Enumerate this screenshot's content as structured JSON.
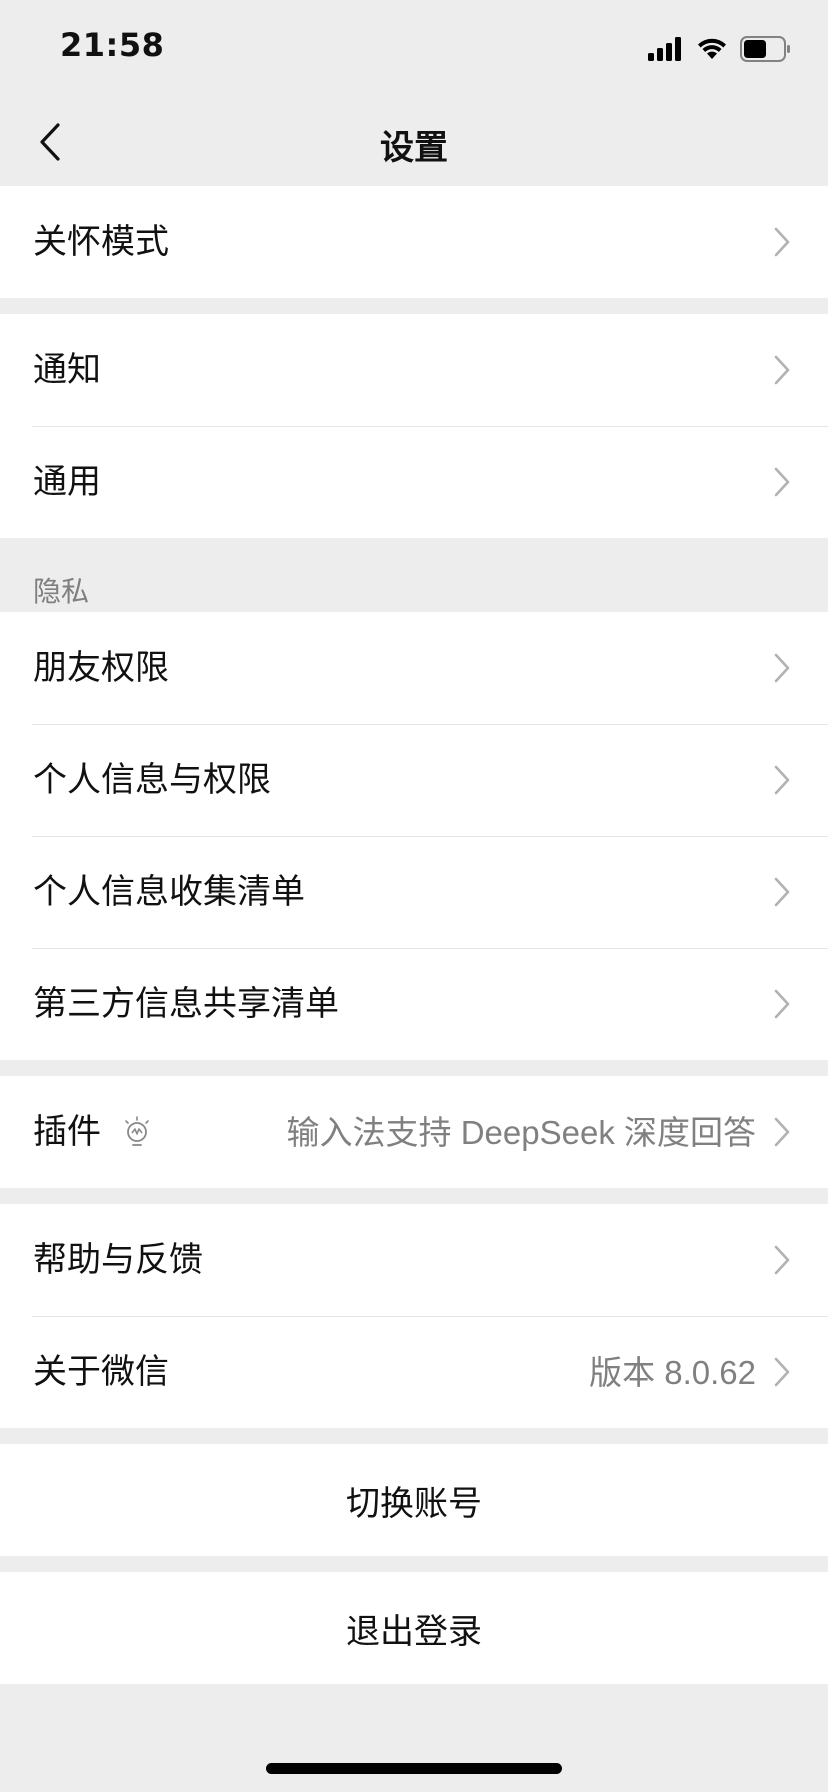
{
  "status_bar": {
    "time": "21:58"
  },
  "nav": {
    "title": "设置"
  },
  "groups": {
    "care": {
      "items": [
        {
          "label": "关怀模式"
        }
      ]
    },
    "general": {
      "items": [
        {
          "label": "通知"
        },
        {
          "label": "通用"
        }
      ]
    },
    "privacy": {
      "header": "隐私",
      "items": [
        {
          "label": "朋友权限"
        },
        {
          "label": "个人信息与权限"
        },
        {
          "label": "个人信息收集清单"
        },
        {
          "label": "第三方信息共享清单"
        }
      ]
    },
    "plugins": {
      "items": [
        {
          "label": "插件",
          "value": "输入法支持 DeepSeek 深度回答"
        }
      ]
    },
    "about": {
      "items": [
        {
          "label": "帮助与反馈"
        },
        {
          "label": "关于微信",
          "value": "版本 8.0.62"
        }
      ]
    }
  },
  "actions": {
    "switch_account": "切换账号",
    "logout": "退出登录"
  },
  "colors": {
    "background": "#ededed",
    "card": "#ffffff",
    "secondary_text": "#808080"
  }
}
